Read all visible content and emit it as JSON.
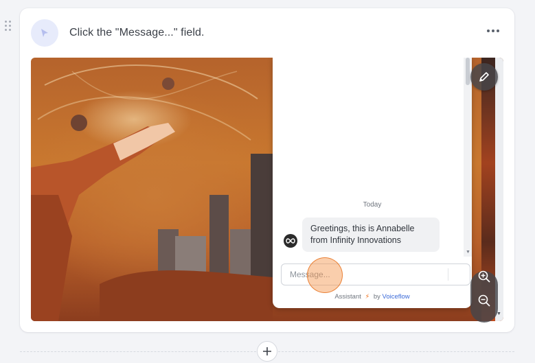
{
  "step": {
    "title": "Click the \"Message...\" field.",
    "more_icon": "ellipsis-icon",
    "avatar_icon": "cursor-icon"
  },
  "chat": {
    "date_label": "Today",
    "bot_message": "Greetings, this is Annabelle from Infinity Innovations",
    "input_placeholder": "Message...",
    "footer_prefix": "Assistant",
    "footer_by": "by",
    "footer_brand": "Voiceflow"
  },
  "tools": {
    "edit_icon": "pencil-icon",
    "zoom_in_icon": "zoom-in-icon",
    "zoom_out_icon": "zoom-out-icon",
    "add_icon": "plus-icon"
  },
  "colors": {
    "accent_orange": "#f59246",
    "brand_blue": "#3b6ad8",
    "avatar_bg": "#e7ebfb"
  }
}
